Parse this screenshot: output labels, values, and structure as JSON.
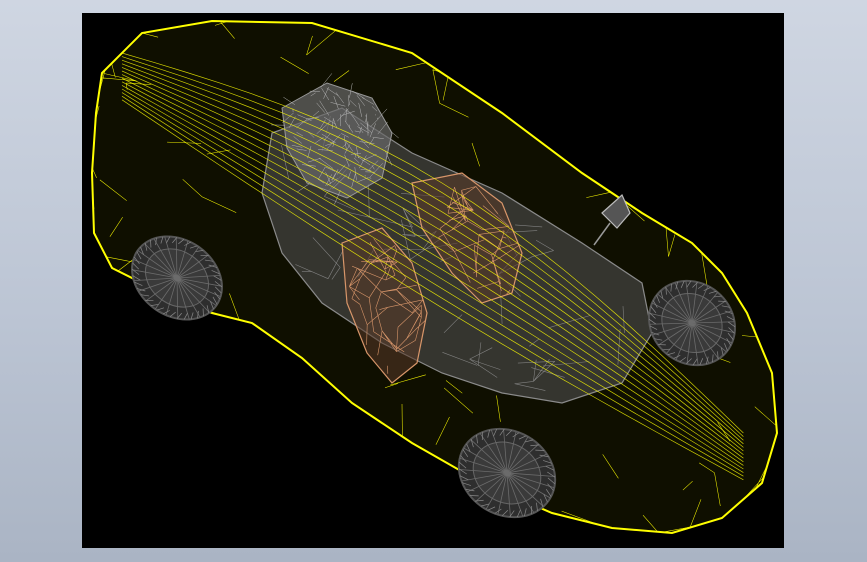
{
  "scene": {
    "description_type": "wireframe-render",
    "background_color": "#000000",
    "frame_color": "#c3cbd8",
    "colors": {
      "body_wire": "#ffff00",
      "interior_wire": "#8a8a8a",
      "seat_wire": "#d8966a",
      "wheel_wire": "#4a4a4a"
    },
    "icons": {
      "model": "sports-car-wireframe-icon"
    }
  }
}
